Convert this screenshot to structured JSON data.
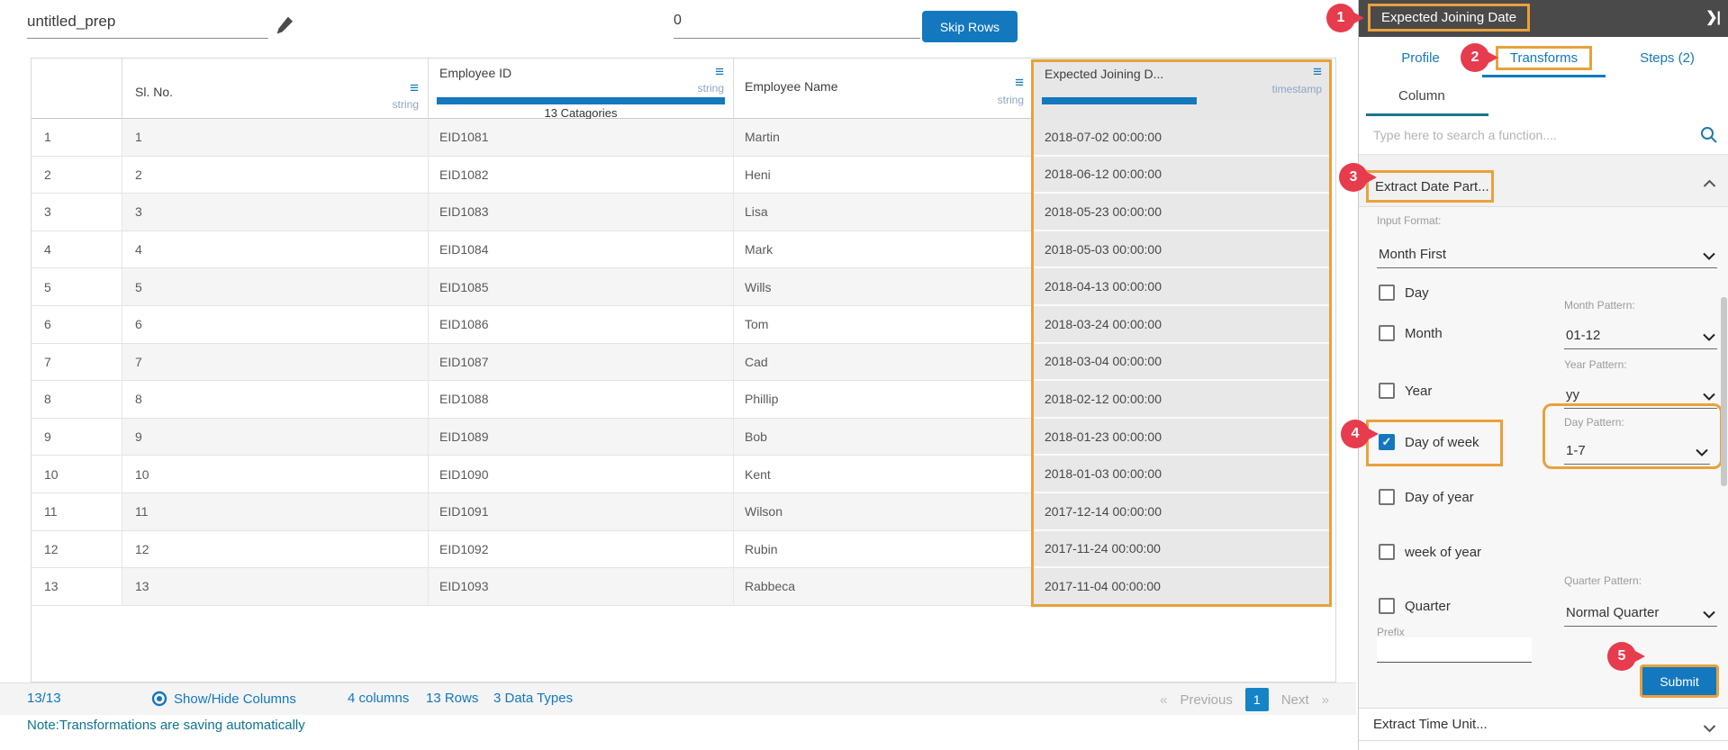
{
  "topbar": {
    "prep_name": "untitled_prep",
    "skip_rows_value": "0",
    "skip_rows_button": "Skip Rows"
  },
  "icons": {
    "menu": "≡",
    "collapse": "❯|"
  },
  "table": {
    "columns": [
      {
        "title": "Sl. No.",
        "type": "string"
      },
      {
        "title": "Employee ID",
        "type": "string",
        "categories": "13 Catagories"
      },
      {
        "title": "Employee Name",
        "type": "string"
      },
      {
        "title": "Expected Joining D...",
        "type": "timestamp"
      }
    ],
    "rows": [
      {
        "index": "1",
        "sl_no": "1",
        "employee_id": "EID1081",
        "employee_name": "Martin",
        "expected_joining": "2018-07-02 00:00:00"
      },
      {
        "index": "2",
        "sl_no": "2",
        "employee_id": "EID1082",
        "employee_name": "Heni",
        "expected_joining": "2018-06-12 00:00:00"
      },
      {
        "index": "3",
        "sl_no": "3",
        "employee_id": "EID1083",
        "employee_name": "Lisa",
        "expected_joining": "2018-05-23 00:00:00"
      },
      {
        "index": "4",
        "sl_no": "4",
        "employee_id": "EID1084",
        "employee_name": "Mark",
        "expected_joining": "2018-05-03 00:00:00"
      },
      {
        "index": "5",
        "sl_no": "5",
        "employee_id": "EID1085",
        "employee_name": "Wills",
        "expected_joining": "2018-04-13 00:00:00"
      },
      {
        "index": "6",
        "sl_no": "6",
        "employee_id": "EID1086",
        "employee_name": "Tom",
        "expected_joining": "2018-03-24 00:00:00"
      },
      {
        "index": "7",
        "sl_no": "7",
        "employee_id": "EID1087",
        "employee_name": "Cad",
        "expected_joining": "2018-03-04 00:00:00"
      },
      {
        "index": "8",
        "sl_no": "8",
        "employee_id": "EID1088",
        "employee_name": "Phillip",
        "expected_joining": "2018-02-12 00:00:00"
      },
      {
        "index": "9",
        "sl_no": "9",
        "employee_id": "EID1089",
        "employee_name": "Bob",
        "expected_joining": "2018-01-23 00:00:00"
      },
      {
        "index": "10",
        "sl_no": "10",
        "employee_id": "EID1090",
        "employee_name": "Kent",
        "expected_joining": "2018-01-03 00:00:00"
      },
      {
        "index": "11",
        "sl_no": "11",
        "employee_id": "EID1091",
        "employee_name": "Wilson",
        "expected_joining": "2017-12-14 00:00:00"
      },
      {
        "index": "12",
        "sl_no": "12",
        "employee_id": "EID1092",
        "employee_name": "Rubin",
        "expected_joining": "2017-11-24 00:00:00"
      },
      {
        "index": "13",
        "sl_no": "13",
        "employee_id": "EID1093",
        "employee_name": "Rabbeca",
        "expected_joining": "2017-11-04 00:00:00"
      }
    ]
  },
  "statusbar": {
    "count": "13/13",
    "show_hide": "Show/Hide Columns",
    "columns_info": "4 columns",
    "rows_info": "13 Rows",
    "types_info": "3 Data Types",
    "note": "Note:Transformations are saving automatically",
    "pagination": {
      "prev_arrow": "«",
      "previous": "Previous",
      "page": "1",
      "next": "Next",
      "next_arrow": "»"
    }
  },
  "panel": {
    "header": {
      "title": "Expected Joining Date",
      "collapse_icon": "❯|"
    },
    "tabs": [
      {
        "label": "Profile"
      },
      {
        "label": "Transforms"
      },
      {
        "label": "Steps (2)"
      }
    ],
    "subtab": "Column",
    "search_placeholder": "Type here to search a function....",
    "extract_date": {
      "title": "Extract Date Part...",
      "input_format_label": "Input Format:",
      "input_format_value": "Month First",
      "checkboxes": [
        {
          "label": "Day",
          "checked": false
        },
        {
          "label": "Month",
          "checked": false,
          "pattern_label": "Month Pattern:",
          "pattern_value": "01-12"
        },
        {
          "label": "Year",
          "checked": false,
          "pattern_label": "Year Pattern:",
          "pattern_value": "yy"
        },
        {
          "label": "Day of week",
          "checked": true,
          "pattern_label": "Day Pattern:",
          "pattern_value": "1-7"
        },
        {
          "label": "Day of year",
          "checked": false
        },
        {
          "label": "week of year",
          "checked": false
        },
        {
          "label": "Quarter",
          "checked": false,
          "pattern_label": "Quarter Pattern:",
          "pattern_value": "Normal Quarter"
        }
      ],
      "prefix_label": "Prefix",
      "prefix_value": "",
      "submit_label": "Submit"
    },
    "extract_time": {
      "title": "Extract Time Unit..."
    }
  },
  "badges": [
    "1",
    "2",
    "3",
    "4",
    "5"
  ],
  "colors": {
    "accent_blue": "#1378be",
    "highlight_orange": "#e9a13b",
    "badge_red": "#e73b4e",
    "panel_header_gray": "#4a4a4a",
    "note_teal": "#0e7490"
  }
}
